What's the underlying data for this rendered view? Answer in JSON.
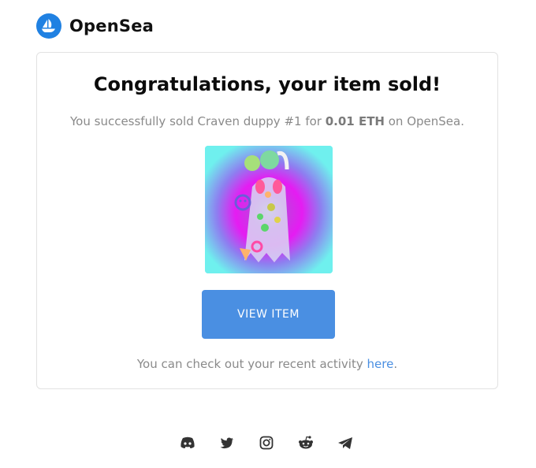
{
  "brand": {
    "name": "OpenSea",
    "color": "#2081e2"
  },
  "card": {
    "title": "Congratulations, your item sold!",
    "message_prefix": "You successfully sold Craven duppy #1 for ",
    "price": "0.01 ETH",
    "message_suffix": " on OpenSea.",
    "item_image_icon": "nft-ghost-artwork",
    "button_label": "VIEW ITEM",
    "activity_text": "You can check out your recent activity ",
    "activity_link": "here",
    "activity_end": "."
  },
  "footer": {
    "icons": [
      "discord-icon",
      "twitter-icon",
      "instagram-icon",
      "reddit-icon",
      "telegram-icon"
    ]
  },
  "colors": {
    "accent": "#4a8fe2",
    "muted_text": "#8a8a8a"
  }
}
